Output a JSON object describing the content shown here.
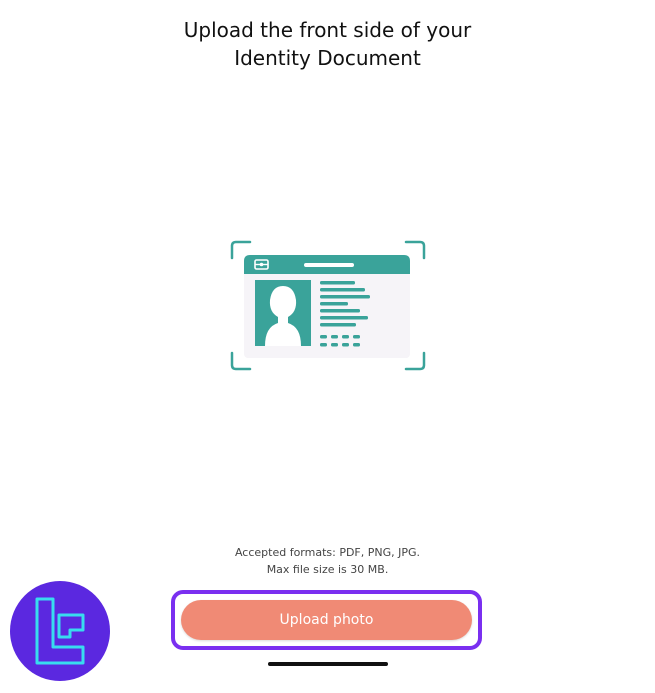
{
  "header": {
    "title_line1": "Upload the front side of your",
    "title_line2": "Identity Document"
  },
  "requirements": {
    "formats": "Accepted formats: PDF, PNG, JPG.",
    "max_size": "Max file size is 30 MB."
  },
  "actions": {
    "upload_label": "Upload photo"
  },
  "colors": {
    "accent_teal": "#3aa39a",
    "button": "#f08a75",
    "highlight_frame": "#7a2ff0",
    "badge_bg": "#5b28e0",
    "badge_mark": "#38dcef"
  },
  "icons": {
    "illustration": "id-card-scan-icon",
    "badge": "brand-logo"
  }
}
